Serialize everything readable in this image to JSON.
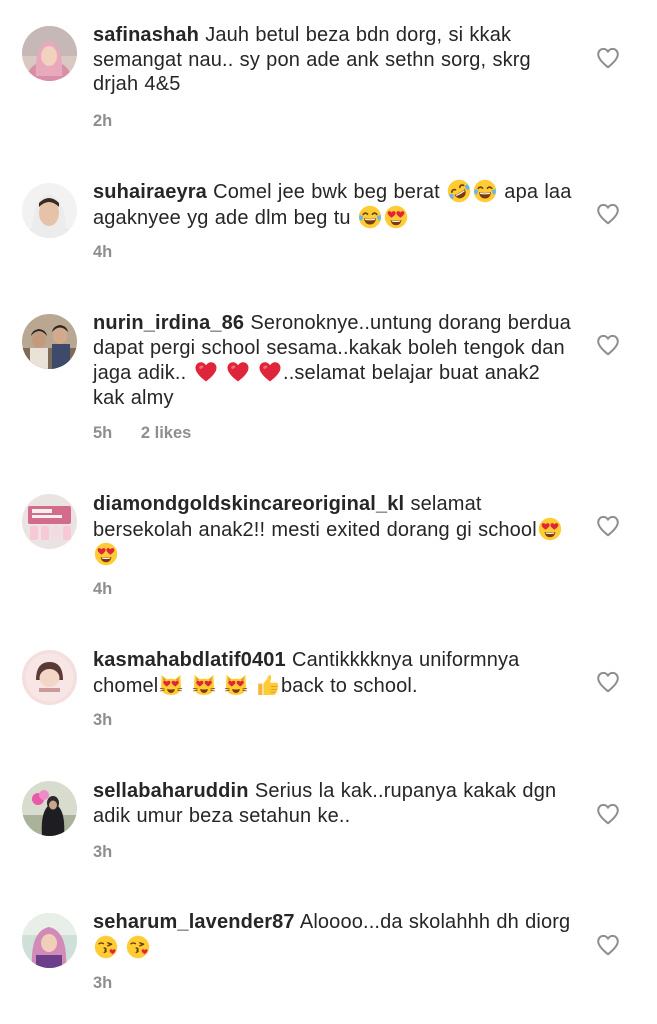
{
  "comments": [
    {
      "username": "safinashah",
      "text": "Jauh betul beza bdn dorg, si kkak semangat nau.. sy pon ade ank sethn sorg, skrg drjah 4&5",
      "time": "2h",
      "likes": ""
    },
    {
      "username": "suhairaeyra",
      "text_1": "Comel jee bwk beg berat",
      "text_2": "apa laa agaknyee yg ade dlm beg tu",
      "time": "4h",
      "likes": ""
    },
    {
      "username": "nurin_irdina_86",
      "text_1": "Seronoknye..untung dorang berdua dapat pergi school sesama..kakak boleh tengok dan jaga adik..",
      "text_2": "..selamat belajar buat anak2 kak almy",
      "time": "5h",
      "likes": "2 likes"
    },
    {
      "username": "diamondgoldskincareoriginal_kl",
      "text": "selamat bersekolah anak2!! mesti exited dorang gi school",
      "time": "4h",
      "likes": ""
    },
    {
      "username": "kasmahabdlatif0401",
      "text_1": "Cantikkkknya uniformnya chomel",
      "text_2": "back to school.",
      "time": "3h",
      "likes": ""
    },
    {
      "username": "sellabaharuddin",
      "text": "Serius la kak..rupanya kakak dgn adik umur beza setahun ke..",
      "time": "3h",
      "likes": ""
    },
    {
      "username": "seharum_lavender87",
      "text": "Aloooo...da skolahhh dh diorg",
      "time": "3h",
      "likes": ""
    }
  ],
  "icons": {
    "like": "heart-outline-icon",
    "rofl": "rolling-on-floor-laughing-emoji",
    "joy": "face-with-tears-of-joy-emoji",
    "heart_eyes": "smiling-face-with-heart-eyes-emoji",
    "red_heart": "red-heart-emoji",
    "heart_eyes_cat": "smiling-cat-with-heart-eyes-emoji",
    "thumbs_up": "thumbs-up-emoji",
    "kiss": "face-blowing-a-kiss-emoji"
  },
  "colors": {
    "text": "#262626",
    "meta": "#8e8e8e",
    "emoji_yellow": "#ffcc33",
    "red_heart": "#e0243a"
  }
}
